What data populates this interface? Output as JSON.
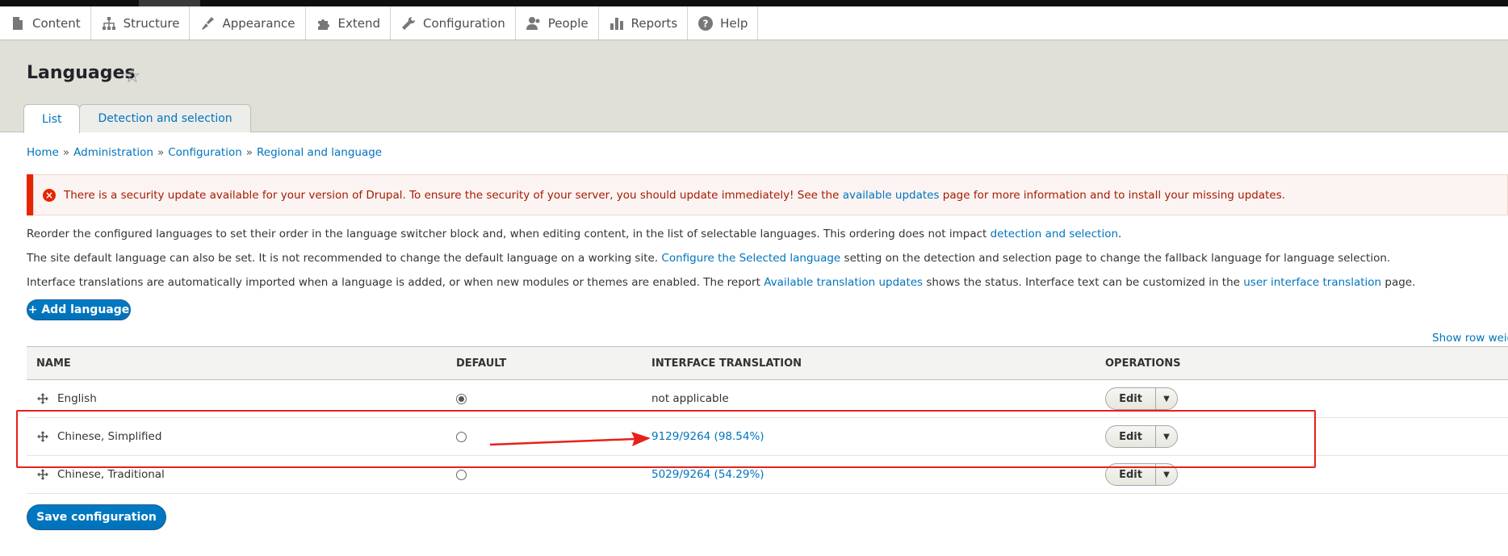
{
  "toolbar": {
    "items": [
      {
        "label": "Content",
        "icon": "file-icon"
      },
      {
        "label": "Structure",
        "icon": "sitemap-icon"
      },
      {
        "label": "Appearance",
        "icon": "paintbrush-icon"
      },
      {
        "label": "Extend",
        "icon": "puzzle-icon"
      },
      {
        "label": "Configuration",
        "icon": "wrench-icon"
      },
      {
        "label": "People",
        "icon": "people-icon"
      },
      {
        "label": "Reports",
        "icon": "bar-chart-icon"
      },
      {
        "label": "Help",
        "icon": "help-icon"
      }
    ]
  },
  "page": {
    "title": "Languages",
    "tabs": [
      "List",
      "Detection and selection"
    ]
  },
  "breadcrumb": [
    "Home",
    "Administration",
    "Configuration",
    "Regional and language"
  ],
  "alert": {
    "text_before": "There is a security update available for your version of Drupal. To ensure the security of your server, you should update immediately! See the ",
    "link": "available updates",
    "text_after": " page for more information and to install your missing updates.",
    "color": "#e62600"
  },
  "paragraphs": {
    "p1_text": "Reorder the configured languages to set their order in the language switcher block and, when editing content, in the list of selectable languages. This ordering does not impact ",
    "p1_link": "detection and selection",
    "p1_end": ".",
    "p2_text": "The site default language can also be set. It is not recommended to change the default language on a working site. ",
    "p2_link": "Configure the Selected language",
    "p2_end": " setting on the detection and selection page to change the fallback language for language selection.",
    "p3_text": "Interface translations are automatically imported when a language is added, or when new modules or themes are enabled. The report ",
    "p3_link1": "Available translation updates",
    "p3_mid": " shows the status. Interface text can be customized in the ",
    "p3_link2": "user interface translation",
    "p3_end": " page."
  },
  "actions": {
    "add_language": "+ Add language",
    "show_weights": "Show row weights",
    "save": "Save configuration"
  },
  "table": {
    "headers": [
      "Name",
      "Default",
      "Interface translation",
      "Operations"
    ],
    "rows": [
      {
        "name": "English",
        "default": true,
        "translation": "not applicable",
        "translation_is_link": false,
        "op": "Edit"
      },
      {
        "name": "Chinese, Simplified",
        "default": false,
        "translation": "9129/9264 (98.54%)",
        "translation_is_link": true,
        "op": "Edit"
      },
      {
        "name": "Chinese, Traditional",
        "default": false,
        "translation": "5029/9264 (54.29%)",
        "translation_is_link": true,
        "op": "Edit"
      }
    ]
  },
  "colors": {
    "link": "#0074bd",
    "primary_button": "#0071b8",
    "annotation": "#e8201a"
  }
}
